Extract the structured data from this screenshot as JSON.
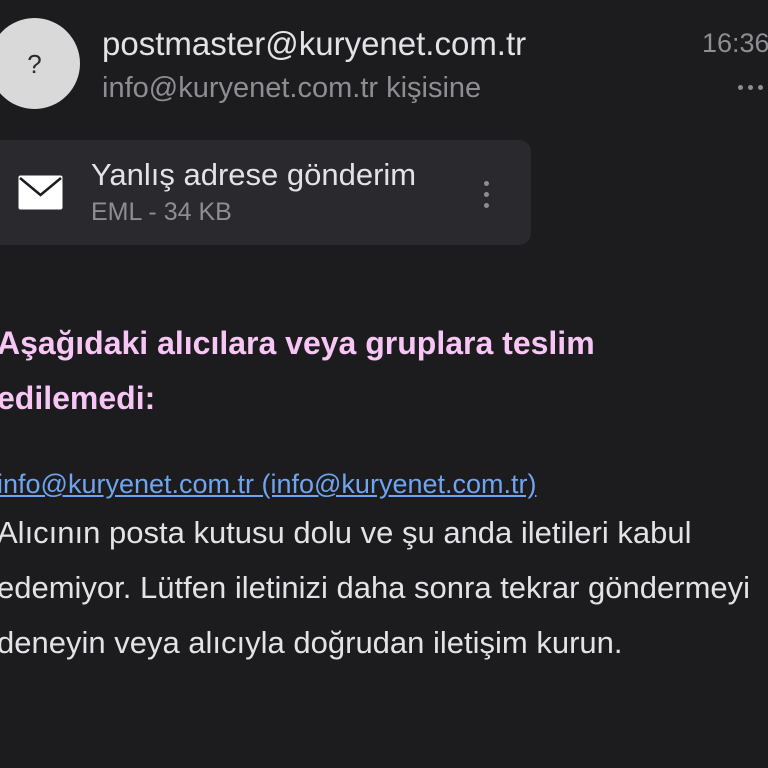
{
  "header": {
    "avatar_glyph": "?",
    "sender": "postmaster@kuryenet.com.tr",
    "recipient": "info@kuryenet.com.tr kişisine",
    "time": "16:36",
    "more_icon": "more-horizontal-icon"
  },
  "attachment": {
    "icon": "mail-icon",
    "name": "Yanlış adrese gönderim",
    "meta": "EML - 34 KB",
    "more_icon": "more-vertical-icon"
  },
  "message": {
    "heading": "Aşağıdaki alıcılara veya gruplara teslim edilemedi:",
    "recipient_link": "info@kuryenet.com.tr (info@kuryenet.com.tr)",
    "body": "Alıcının posta kutusu dolu ve şu anda iletileri kabul edemiyor. Lütfen iletinizi daha sonra tekrar göndermeyi deneyin veya alıcıyla doğrudan iletişim kurun."
  },
  "colors": {
    "background": "#1c1b1e",
    "heading": "#f7c6f5",
    "link": "#6ea4f0",
    "card": "#2a292d"
  }
}
